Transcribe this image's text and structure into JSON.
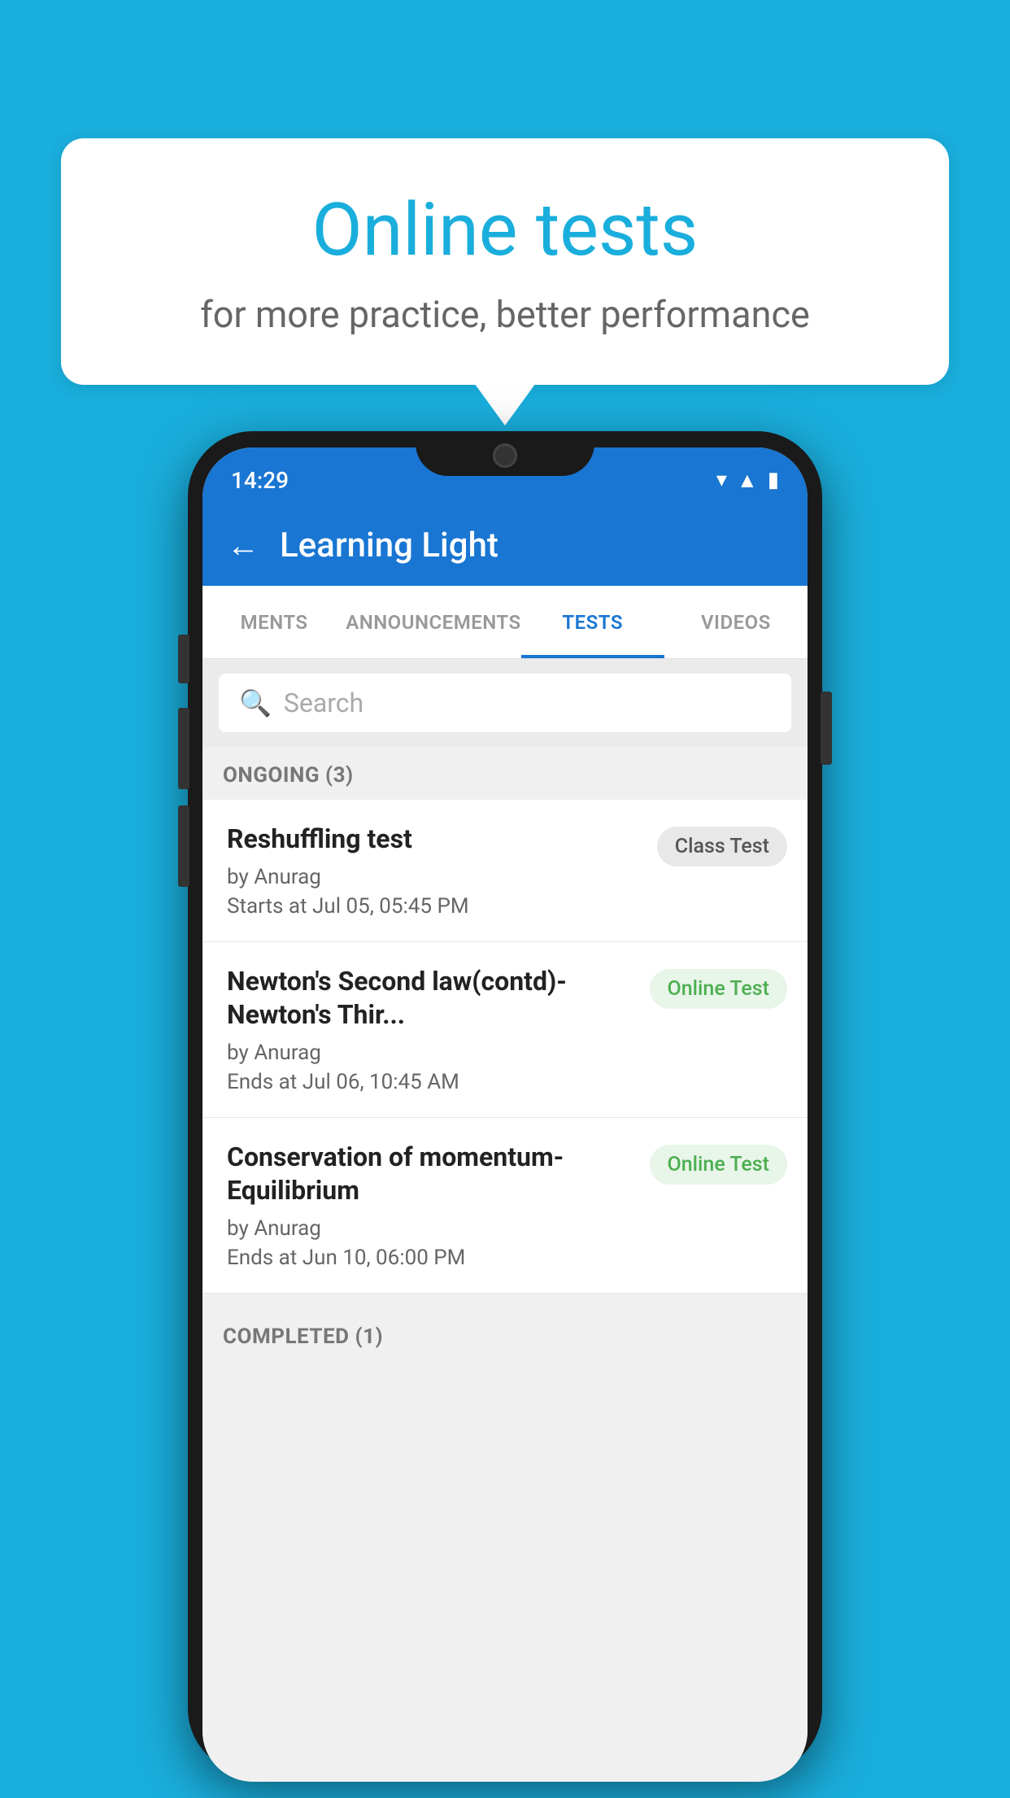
{
  "background": {
    "color": "#1AAEDC"
  },
  "speech_bubble": {
    "title": "Online tests",
    "subtitle": "for more practice, better performance"
  },
  "phone": {
    "status_bar": {
      "time": "14:29",
      "icons": [
        "wifi",
        "signal",
        "battery"
      ]
    },
    "app_bar": {
      "back_label": "←",
      "title": "Learning Light"
    },
    "tabs": [
      {
        "label": "MENTS",
        "active": false
      },
      {
        "label": "ANNOUNCEMENTS",
        "active": false
      },
      {
        "label": "TESTS",
        "active": true
      },
      {
        "label": "VIDEOS",
        "active": false
      }
    ],
    "search": {
      "placeholder": "Search"
    },
    "sections": [
      {
        "header": "ONGOING (3)",
        "items": [
          {
            "name": "Reshuffling test",
            "author": "by Anurag",
            "time_label": "Starts at",
            "time": "Jul 05, 05:45 PM",
            "badge": "Class Test",
            "badge_type": "class"
          },
          {
            "name": "Newton's Second law(contd)-Newton's Thir...",
            "author": "by Anurag",
            "time_label": "Ends at",
            "time": "Jul 06, 10:45 AM",
            "badge": "Online Test",
            "badge_type": "online"
          },
          {
            "name": "Conservation of momentum-Equilibrium",
            "author": "by Anurag",
            "time_label": "Ends at",
            "time": "Jun 10, 06:00 PM",
            "badge": "Online Test",
            "badge_type": "online"
          }
        ]
      },
      {
        "header": "COMPLETED (1)",
        "items": []
      }
    ]
  }
}
